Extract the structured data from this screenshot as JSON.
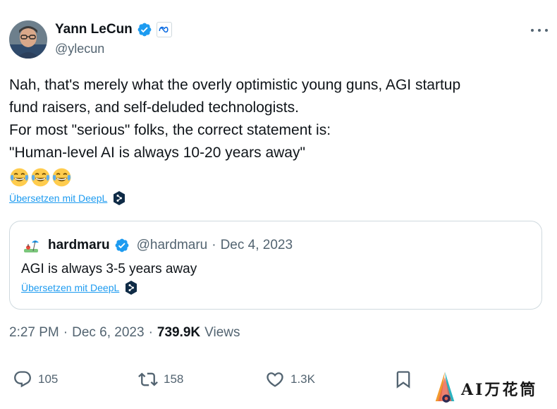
{
  "author": {
    "display_name": "Yann LeCun",
    "handle": "@ylecun",
    "verified": true,
    "affiliation_icon": "meta-logo-icon"
  },
  "tweet": {
    "lines": [
      "Nah, that's merely what the overly optimistic young guns, AGI startup",
      "fund raisers, and self-deluded technologists.",
      "For most \"serious\" folks, the correct statement is:",
      "\"Human-level AI is always 10-20 years away\""
    ],
    "emojis": [
      "face-with-tears-of-joy",
      "face-with-tears-of-joy",
      "face-with-tears-of-joy"
    ],
    "translate_label": "Übersetzen mit DeepL"
  },
  "quote": {
    "display_name": "hardmaru",
    "handle": "@hardmaru",
    "separator": "·",
    "date": "Dec 4, 2023",
    "text": "AGI is always 3-5 years away",
    "translate_label": "Übersetzen mit DeepL"
  },
  "meta": {
    "time": "2:27 PM",
    "separator": "·",
    "date": "Dec 6, 2023",
    "views_count": "739.9K",
    "views_label": "Views"
  },
  "actions": {
    "replies": "105",
    "reposts": "158",
    "likes": "1.3K"
  },
  "watermark": {
    "text": "AI万花筒"
  },
  "colors": {
    "accent": "#1d9bf0",
    "text_primary": "#0f1419",
    "text_secondary": "#536471",
    "border": "#cfd9de"
  }
}
